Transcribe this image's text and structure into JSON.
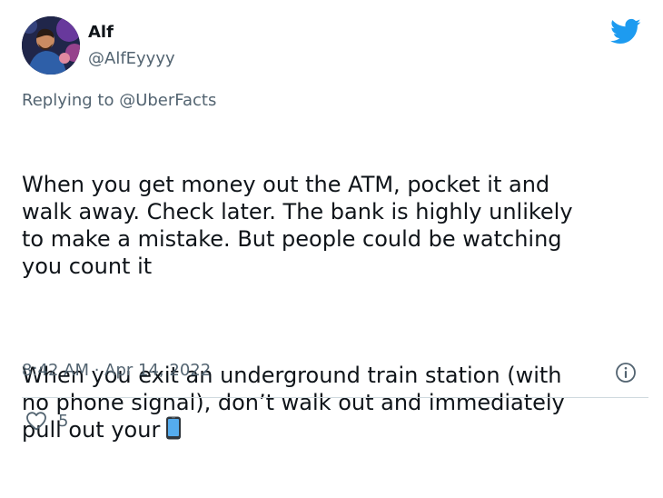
{
  "tweet": {
    "author_name": "Alf",
    "author_handle": "@AlfEyyyy",
    "reply_prefix": "Replying to ",
    "reply_to": "@UberFacts",
    "paragraph_1": "When you get money out the ATM, pocket it and\nwalk away. Check later. The bank is highly unlikely\nto make a mistake. But people could be watching\nyou count it",
    "paragraph_2": "When you exit an underground train station (with\nno phone signal), don’t walk out and immediately\npull out your",
    "timestamp": "8:42 AM · Apr 14, 2022",
    "like_count": "5"
  },
  "icons": {
    "logo": "twitter-bird-icon",
    "emoji": "mobile-phone-icon",
    "info": "info-icon",
    "like": "heart-icon"
  },
  "colors": {
    "brand": "#1d9bf0",
    "text": "#0f1419",
    "secondary": "#536471",
    "divider": "#cfd9de"
  }
}
